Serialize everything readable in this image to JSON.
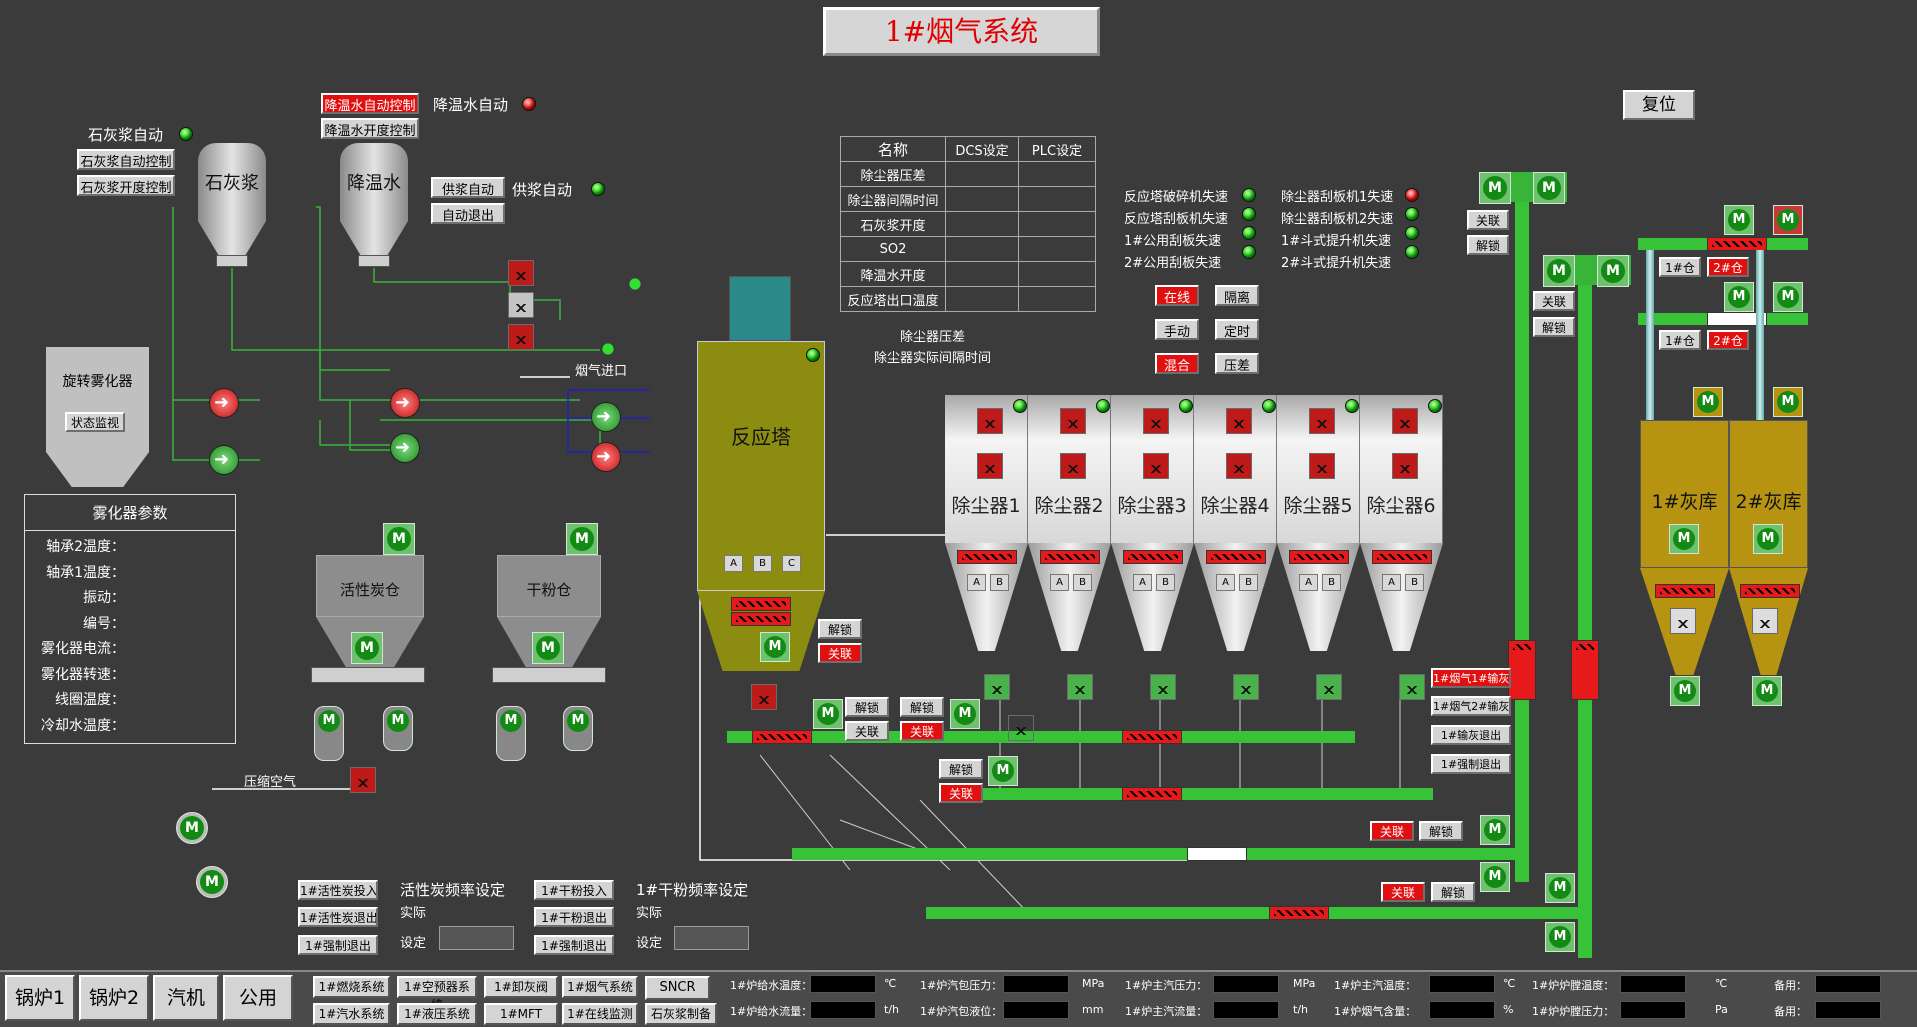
{
  "title": "1#烟气系统",
  "reset": "复位",
  "limewater": {
    "auto_label": "石灰浆自动",
    "btn_auto": "石灰浆自动控制",
    "btn_open": "石灰浆开度控制",
    "tank": "石灰浆"
  },
  "coolwater": {
    "btn_auto": "降温水自动控制",
    "btn_open": "降温水开度控制",
    "auto_label": "降温水自动",
    "tank": "降温水"
  },
  "slurry": {
    "btn_auto": "供浆自动",
    "btn_exit": "自动退出",
    "auto_label": "供浆自动"
  },
  "atomizer": {
    "title": "旋转雾化器",
    "status_btn": "状态监视",
    "params_title": "雾化器参数",
    "params": [
      "轴承2温度：",
      "轴承1温度：",
      "振动：",
      "编号：",
      "雾化器电流：",
      "雾化器转速：",
      "线圈温度：",
      "冷却水温度："
    ]
  },
  "param_table": {
    "headers": [
      "名称",
      "DCS设定",
      "PLC设定"
    ],
    "rows": [
      "除尘器压差",
      "除尘器间隔时间",
      "石灰浆开度",
      "SO2",
      "降温水开度",
      "反应塔出口温度"
    ]
  },
  "notes": [
    "除尘器压差",
    "除尘器实际间隔时间"
  ],
  "status_list": {
    "left": [
      "反应塔破碎机失速",
      "反应塔刮板机失速",
      "1#公用刮板失速",
      "2#公用刮板失速"
    ],
    "right": [
      "除尘器刮板机1失速",
      "除尘器刮板机2失速",
      "1#斗式提升机失速",
      "2#斗式提升机失速"
    ]
  },
  "mode_btns": [
    "在线",
    "隔离",
    "手动",
    "定时",
    "混合",
    "压差"
  ],
  "tower": {
    "label": "反应塔",
    "abc": [
      "A",
      "B",
      "C"
    ],
    "unlock": "解锁",
    "link": "关联"
  },
  "gas_inlet": "烟气进口",
  "comp_air": "压缩空气",
  "dust": [
    "除尘器1",
    "除尘器2",
    "除尘器3",
    "除尘器4",
    "除尘器5",
    "除尘器6"
  ],
  "ab": [
    "A",
    "B"
  ],
  "silos": {
    "carbon": "活性炭仓",
    "powder": "干粉仓",
    "ash1": "1#灰库",
    "ash2": "2#灰库"
  },
  "bin": {
    "b1": "1#仓",
    "b2": "2#仓"
  },
  "ash_cmds": [
    "1#烟气1#输灰",
    "1#烟气2#输灰",
    "1#输灰退出",
    "1#强制退出"
  ],
  "ctrl": {
    "unlock": "解锁",
    "link": "关联"
  },
  "feed": {
    "carbon_btns": [
      "1#活性炭投入",
      "1#活性炭退出",
      "1#强制退出"
    ],
    "carbon_freq": "活性炭频率设定",
    "powder_btns": [
      "1#干粉投入",
      "1#干粉退出",
      "1#强制退出"
    ],
    "powder_freq": "1#干粉频率设定",
    "actual": "实际",
    "set": "设定"
  },
  "nav": {
    "main": [
      "锅炉1",
      "锅炉2",
      "汽机",
      "公用"
    ],
    "sub": [
      "1#燃烧系统",
      "1#空预器系统",
      "1#卸灰阀",
      "1#烟气系统",
      "SNCR",
      "1#汽水系统",
      "1#液压系统",
      "1#MFT",
      "1#在线监测",
      "石灰浆制备"
    ]
  },
  "readings": [
    {
      "label": "1#炉给水温度：",
      "unit": "℃"
    },
    {
      "label": "1#炉汽包压力：",
      "unit": "MPa"
    },
    {
      "label": "1#炉主汽压力：",
      "unit": "MPa"
    },
    {
      "label": "1#炉主汽温度：",
      "unit": "℃"
    },
    {
      "label": "1#炉炉膛温度：",
      "unit": "℃"
    },
    {
      "label": "备用：",
      "unit": ""
    },
    {
      "label": "1#炉给水流量：",
      "unit": "t/h"
    },
    {
      "label": "1#炉汽包液位：",
      "unit": "mm"
    },
    {
      "label": "1#炉主汽流量：",
      "unit": "t/h"
    },
    {
      "label": "1#炉烟气含量：",
      "unit": "%"
    },
    {
      "label": "1#炉炉膛压力：",
      "unit": "Pa"
    },
    {
      "label": "备用：",
      "unit": ""
    }
  ]
}
